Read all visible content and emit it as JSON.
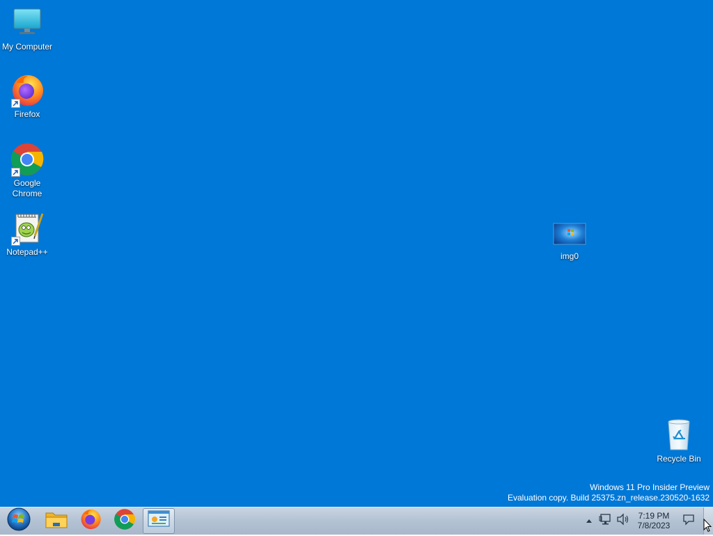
{
  "desktop": {
    "background_color": "#0078d7",
    "icons": [
      {
        "label": "My Computer",
        "icon": "computer-icon"
      },
      {
        "label": "Firefox",
        "icon": "firefox-icon",
        "shortcut": true
      },
      {
        "label": "Google Chrome",
        "icon": "chrome-icon",
        "shortcut": true
      },
      {
        "label": "Notepad++",
        "icon": "notepadpp-icon",
        "shortcut": true
      },
      {
        "label": "img0",
        "icon": "image-file-icon"
      },
      {
        "label": "Recycle Bin",
        "icon": "recycle-bin-icon"
      }
    ],
    "watermark": {
      "line1": "Windows 11 Pro Insider Preview",
      "line2": "Evaluation copy. Build 25375.zn_release.230520-1632"
    }
  },
  "taskbar": {
    "start_icon": "windows-orb-icon",
    "pinned": [
      {
        "name": "File Explorer",
        "icon": "folder-icon"
      },
      {
        "name": "Firefox",
        "icon": "firefox-icon"
      },
      {
        "name": "Google Chrome",
        "icon": "chrome-icon"
      },
      {
        "name": "Control Panel",
        "icon": "control-panel-icon",
        "active": true
      }
    ],
    "tray": {
      "icons": [
        "chevron-up-icon",
        "network-icon",
        "volume-icon"
      ],
      "time": "7:19 PM",
      "date": "7/8/2023",
      "notification_icon": "notification-icon"
    }
  }
}
